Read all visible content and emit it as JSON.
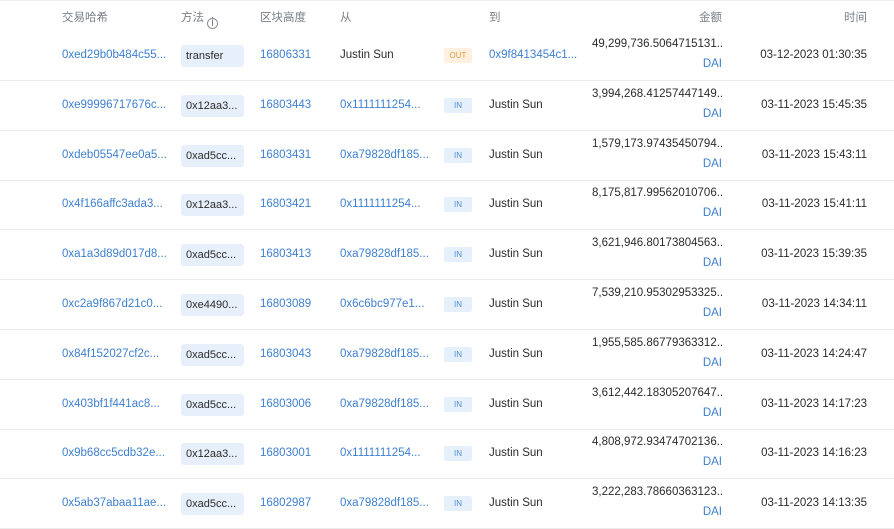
{
  "columns": {
    "hash": "交易哈希",
    "method": "方法",
    "block": "区块高度",
    "from": "从",
    "to": "到",
    "amount": "金额",
    "time": "时间"
  },
  "rows": [
    {
      "hash": "0xed29b0b484c55...",
      "method": "transfer",
      "block": "16806331",
      "from": "Justin Sun",
      "dir": "OUT",
      "to": "0x9f8413454c1...",
      "amount": "49,299,736.5064715131...",
      "token": "DAI",
      "time": "03-12-2023 01:30:35"
    },
    {
      "hash": "0xe99996717676c...",
      "method": "0x12aa3...",
      "block": "16803443",
      "from": "0x1111111254...",
      "dir": "IN",
      "to": "Justin Sun",
      "amount": "3,994,268.41257447149...",
      "token": "DAI",
      "time": "03-11-2023 15:45:35"
    },
    {
      "hash": "0xdeb05547ee0a5...",
      "method": "0xad5cc...",
      "block": "16803431",
      "from": "0xa79828df185...",
      "dir": "IN",
      "to": "Justin Sun",
      "amount": "1,579,173.97435450794...",
      "token": "DAI",
      "time": "03-11-2023 15:43:11"
    },
    {
      "hash": "0x4f166affc3ada3...",
      "method": "0x12aa3...",
      "block": "16803421",
      "from": "0x1111111254...",
      "dir": "IN",
      "to": "Justin Sun",
      "amount": "8,175,817.99562010706...",
      "token": "DAI",
      "time": "03-11-2023 15:41:11"
    },
    {
      "hash": "0xa1a3d89d017d8...",
      "method": "0xad5cc...",
      "block": "16803413",
      "from": "0xa79828df185...",
      "dir": "IN",
      "to": "Justin Sun",
      "amount": "3,621,946.80173804563...",
      "token": "DAI",
      "time": "03-11-2023 15:39:35"
    },
    {
      "hash": "0xc2a9f867d21c0...",
      "method": "0xe4490...",
      "block": "16803089",
      "from": "0x6c6bc977e1...",
      "dir": "IN",
      "to": "Justin Sun",
      "amount": "7,539,210.95302953325...",
      "token": "DAI",
      "time": "03-11-2023 14:34:11"
    },
    {
      "hash": "0x84f152027cf2c...",
      "method": "0xad5cc...",
      "block": "16803043",
      "from": "0xa79828df185...",
      "dir": "IN",
      "to": "Justin Sun",
      "amount": "1,955,585.86779363312...",
      "token": "DAI",
      "time": "03-11-2023 14:24:47"
    },
    {
      "hash": "0x403bf1f441ac8...",
      "method": "0xad5cc...",
      "block": "16803006",
      "from": "0xa79828df185...",
      "dir": "IN",
      "to": "Justin Sun",
      "amount": "3,612,442.18305207647...",
      "token": "DAI",
      "time": "03-11-2023 14:17:23"
    },
    {
      "hash": "0x9b68cc5cdb32e...",
      "method": "0x12aa3...",
      "block": "16803001",
      "from": "0x1111111254...",
      "dir": "IN",
      "to": "Justin Sun",
      "amount": "4,808,972.93474702136...",
      "token": "DAI",
      "time": "03-11-2023 14:16:23"
    },
    {
      "hash": "0x5ab37abaa11ae...",
      "method": "0xad5cc...",
      "block": "16802987",
      "from": "0xa79828df185...",
      "dir": "IN",
      "to": "Justin Sun",
      "amount": "3,222,283.78660363123...",
      "token": "DAI",
      "time": "03-11-2023 14:13:35"
    }
  ]
}
